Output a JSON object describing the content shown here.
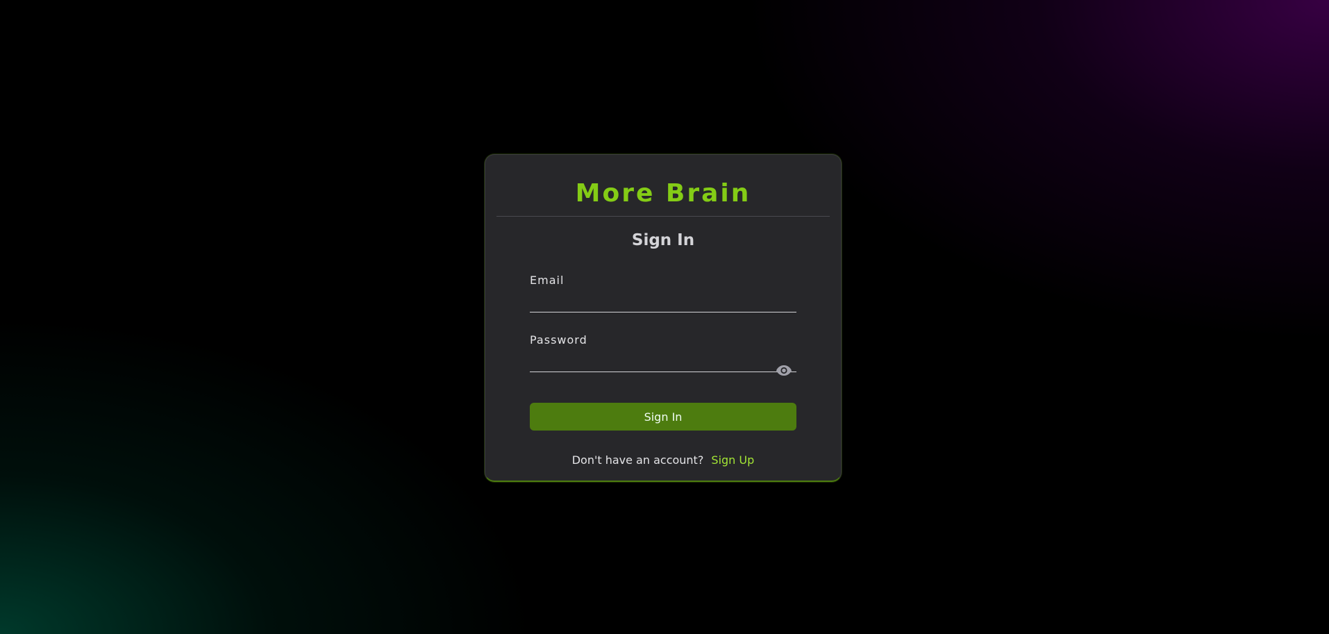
{
  "brand": {
    "title": "More Brain"
  },
  "form": {
    "heading": "Sign In",
    "email": {
      "label": "Email",
      "value": "",
      "placeholder": ""
    },
    "password": {
      "label": "Password",
      "value": "",
      "placeholder": ""
    },
    "toggle_icon": "eye-icon",
    "submit_label": "Sign In"
  },
  "footer": {
    "prompt": "Don't have an account?",
    "link_label": "Sign Up"
  },
  "colors": {
    "accent": "#84cc16",
    "button": "#4d7c0f",
    "link": "#a3e635",
    "card": "#27272a"
  }
}
